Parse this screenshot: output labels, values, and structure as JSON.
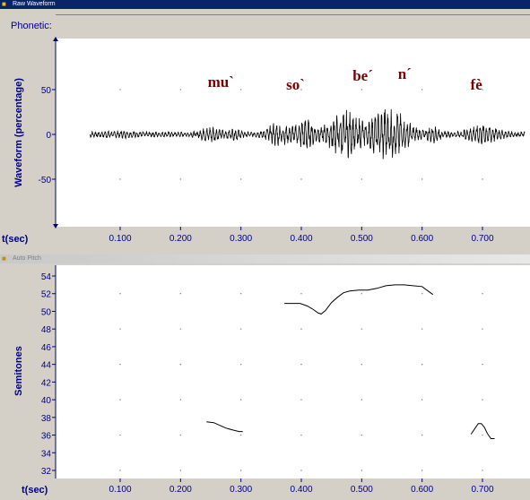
{
  "windows": {
    "waveform": {
      "title": "Raw Waveform",
      "phonetic_label": "Phonetic:"
    },
    "pitch": {
      "title": "Auto Pitch"
    }
  },
  "waveform_panel": {
    "ylabel": "Waveform (percentage)",
    "yticks": [
      "50",
      "0",
      "-50"
    ],
    "xlabel": "t(sec)",
    "xticks": [
      "0.100",
      "0.200",
      "0.300",
      "0.400",
      "0.500",
      "0.600",
      "0.700"
    ],
    "syllables": [
      {
        "text": "mu`",
        "t": 0.245
      },
      {
        "text": "so`",
        "t": 0.375
      },
      {
        "text": "be´",
        "t": 0.485
      },
      {
        "text": "n´",
        "t": 0.56
      },
      {
        "text": "fè",
        "t": 0.68
      }
    ]
  },
  "pitch_panel": {
    "ylabel": "Semitones",
    "yticks": [
      "54",
      "52",
      "50",
      "48",
      "46",
      "44",
      "42",
      "40",
      "38",
      "36",
      "34",
      "32"
    ],
    "xlabel": "t(sec)",
    "xticks": [
      "0.100",
      "0.200",
      "0.300",
      "0.400",
      "0.500",
      "0.600",
      "0.700"
    ]
  },
  "chart_data": [
    {
      "type": "line",
      "ylabel": "Waveform (percentage)",
      "xlabel": "t(sec)",
      "ylim": [
        -100,
        100
      ],
      "xlim": [
        0.03,
        0.77
      ],
      "description_series": "raw audio waveform"
    },
    {
      "type": "line",
      "ylabel": "Semitones",
      "xlabel": "t(sec)",
      "ylim": [
        31.5,
        55
      ],
      "xlim": [
        0.03,
        0.77
      ],
      "series": [
        {
          "x": [
            0.243,
            0.255,
            0.265,
            0.275,
            0.285,
            0.297,
            0.303
          ],
          "y": [
            37.5,
            37.4,
            37.1,
            36.8,
            36.6,
            36.4,
            36.4
          ]
        },
        {
          "x": [
            0.372,
            0.385,
            0.398,
            0.41,
            0.42,
            0.428,
            0.433,
            0.44,
            0.45,
            0.46,
            0.47,
            0.48,
            0.495,
            0.51,
            0.525,
            0.54,
            0.555,
            0.57,
            0.585,
            0.6,
            0.612,
            0.618
          ],
          "y": [
            50.9,
            50.9,
            50.9,
            50.6,
            50.2,
            49.8,
            49.7,
            50.1,
            51.0,
            51.6,
            52.1,
            52.3,
            52.4,
            52.4,
            52.6,
            52.9,
            53.0,
            53.0,
            52.9,
            52.8,
            52.2,
            51.9
          ]
        },
        {
          "x": [
            0.681,
            0.688,
            0.693,
            0.698,
            0.703,
            0.708,
            0.714,
            0.72
          ],
          "y": [
            36.1,
            36.8,
            37.3,
            37.3,
            36.9,
            36.2,
            35.6,
            35.6
          ]
        }
      ]
    }
  ]
}
